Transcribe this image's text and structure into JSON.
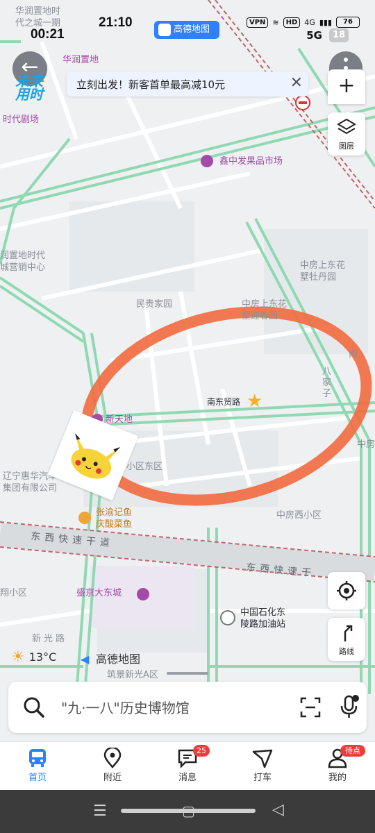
{
  "status_bar": {
    "time": "21:10",
    "time_secondary": "00:21",
    "vpn": "VPN",
    "hd": "HD",
    "network": "4G",
    "battery": "76",
    "network_secondary": "5G",
    "secondary_badge": "18",
    "app_chip": "高德地图"
  },
  "banner": {
    "back_icon": "arrow-left-icon",
    "slogan": "未来用时",
    "promo_text": "立刻出发！新客首单最高减10元",
    "close_icon": "close-icon"
  },
  "controls": {
    "layers_label": "图层",
    "locate_icon": "crosshair-icon",
    "route_label": "路线"
  },
  "map_labels": {
    "top_left_a": "华润置地时",
    "top_left_b": "代之城一期",
    "huarun": "华润置地",
    "huarun2": "时代剧场",
    "market": "鑫中发果品市场",
    "sales_a": "润置地时代",
    "sales_b": "城营销中心",
    "minggui": "民贵家园",
    "zhongfang_a": "中房上东花",
    "zhongfang_b": "墅牡丹园",
    "yingchun_a": "中房上东花",
    "yingchun_b": "墅迎春园",
    "nandong": "南东贸路",
    "xintiandi": "新天地",
    "xiaoqu": "小区东区",
    "huihua_a": "辽宁惠华汽车",
    "huihua_b": "集团有限公司",
    "zhangyu_a": "张渝记鱼",
    "zhangyu_b": "庆酸菜鱼",
    "zhongfangxi": "中房西小区",
    "expressway": "东西快速干道",
    "expressway2": "东西快速干",
    "shengjing": "盛京大东城",
    "xiaoqu2": "翔小区",
    "sinopec_a": "中国石化东",
    "sinopec_b": "陵路加油站",
    "xinguang": "新光路",
    "zhujing": "筑景新光A区",
    "nan_road": "南",
    "bajia": "八家子",
    "zhongfang_edge": "中房"
  },
  "weather": {
    "temp": "13°C",
    "brand": "高德地图"
  },
  "search": {
    "placeholder": "\"九·一八\"历史博物馆"
  },
  "tabs": [
    {
      "label": "首页",
      "icon": "bus-icon",
      "active": true
    },
    {
      "label": "附近",
      "icon": "location-pin-icon"
    },
    {
      "label": "消息",
      "icon": "message-icon",
      "badge": "25"
    },
    {
      "label": "打车",
      "icon": "taxi-arrow-icon"
    },
    {
      "label": "我的",
      "icon": "person-icon",
      "badge": "待点亮"
    }
  ],
  "colors": {
    "accent": "#2f80ff",
    "circle": "#f26a3f",
    "road_green": "#8fd9b2",
    "poi_purple": "#a54aa8"
  }
}
